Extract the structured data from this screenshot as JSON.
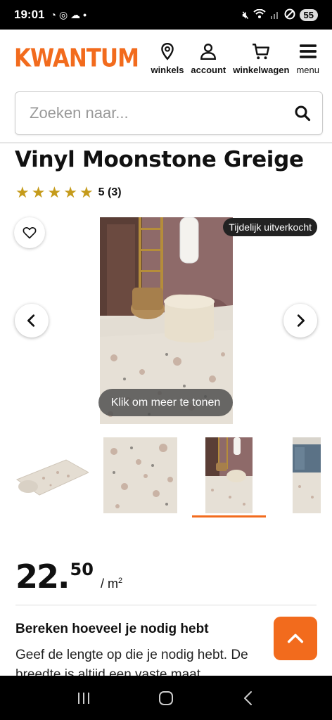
{
  "status_bar": {
    "time": "19:01",
    "battery": "55"
  },
  "header": {
    "logo": "KWANTUM",
    "nav": [
      {
        "label": "winkels",
        "icon": "location-pin-icon"
      },
      {
        "label": "account",
        "icon": "user-icon"
      },
      {
        "label": "winkelwagen",
        "icon": "cart-icon"
      },
      {
        "label": "menu",
        "icon": "hamburger-menu-icon"
      }
    ]
  },
  "search": {
    "placeholder": "Zoeken naar..."
  },
  "product": {
    "title": "Vinyl Moonstone Greige",
    "rating_value": "5 (3)",
    "stars": 5,
    "badge": "Tijdelijk uitverkocht",
    "show_more": "Klik om meer te tonen",
    "price_main": "22.",
    "price_cents": "50",
    "price_unit": "/ m",
    "price_unit_sup": "2"
  },
  "calculator": {
    "title": "Bereken hoeveel je nodig hebt",
    "text": "Geef de lengte op die je nodig hebt. De breedte is altijd een vaste maat."
  },
  "colors": {
    "brand": "#f26b1d",
    "star": "#c59b1b"
  }
}
